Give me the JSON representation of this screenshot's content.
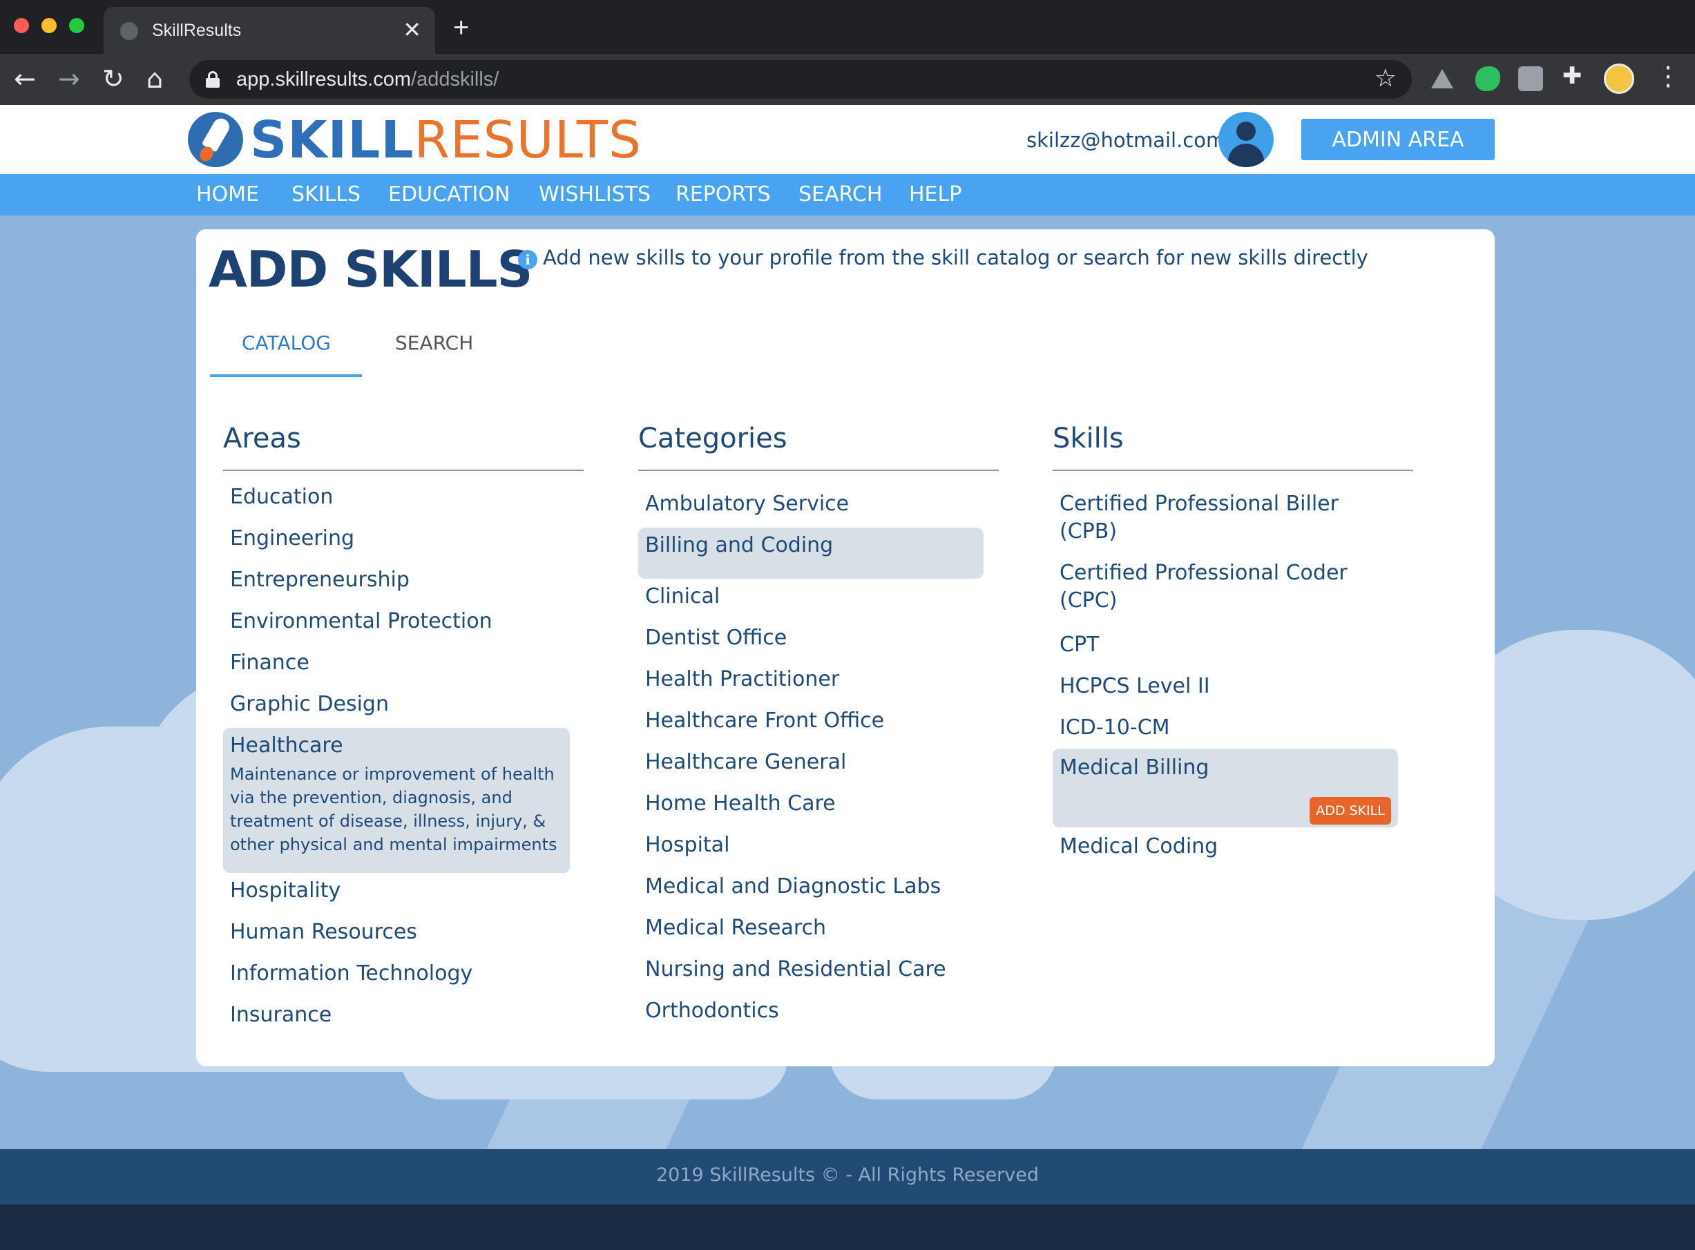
{
  "browser": {
    "tab_title": "SkillResults",
    "tab_close": "✕",
    "new_tab": "+",
    "url_host": "app.skillresults.com",
    "url_path": "/addskills/"
  },
  "site": {
    "brand_part1": "SKILL",
    "brand_part2": "RESULTS",
    "user_email": "skilzz@hotmail.com",
    "admin_button": "ADMIN AREA",
    "colors": {
      "brand_blue": "#2d6fb8",
      "brand_orange": "#e8742e",
      "nav_blue": "#4aa3f0",
      "text_navy": "#1f4a78"
    }
  },
  "nav": {
    "items": [
      "HOME",
      "SKILLS",
      "EDUCATION",
      "WISHLISTS",
      "REPORTS",
      "SEARCH",
      "HELP"
    ]
  },
  "main": {
    "title": "ADD SKILLS",
    "info_text": "Add new skills to your profile from the skill catalog or search for new skills directly",
    "tabs": [
      "CATALOG",
      "SEARCH"
    ],
    "active_tab": "CATALOG"
  },
  "areas": {
    "title": "Areas",
    "items": [
      "Education",
      "Engineering",
      "Entrepreneurship",
      "Environmental Protection",
      "Finance",
      "Graphic Design",
      "Healthcare",
      "Hospitality",
      "Human Resources",
      "Information Technology",
      "Insurance"
    ],
    "selected": "Healthcare",
    "selected_description": "Maintenance or improvement of health via the prevention, diagnosis, and treatment of disease, illness, injury, & other physical and mental impairments"
  },
  "categories": {
    "title": "Categories",
    "items": [
      "Ambulatory Service",
      "Billing and Coding",
      "Clinical",
      "Dentist Office",
      "Health Practitioner",
      "Healthcare Front Office",
      "Healthcare General",
      "Home Health Care",
      "Hospital",
      "Medical and Diagnostic Labs",
      "Medical Research",
      "Nursing and Residential Care",
      "Orthodontics"
    ],
    "selected": "Billing and Coding"
  },
  "skills": {
    "title": "Skills",
    "items": [
      "Certified Professional Biller (CPB)",
      "Certified Professional Coder (CPC)",
      "CPT",
      "HCPCS Level II",
      "ICD-10-CM",
      "Medical Billing",
      "Medical Coding"
    ],
    "selected": "Medical Billing",
    "add_skill_button": "ADD SKILL"
  },
  "footer": {
    "text": "2019 SkillResults © - All Rights Reserved"
  }
}
